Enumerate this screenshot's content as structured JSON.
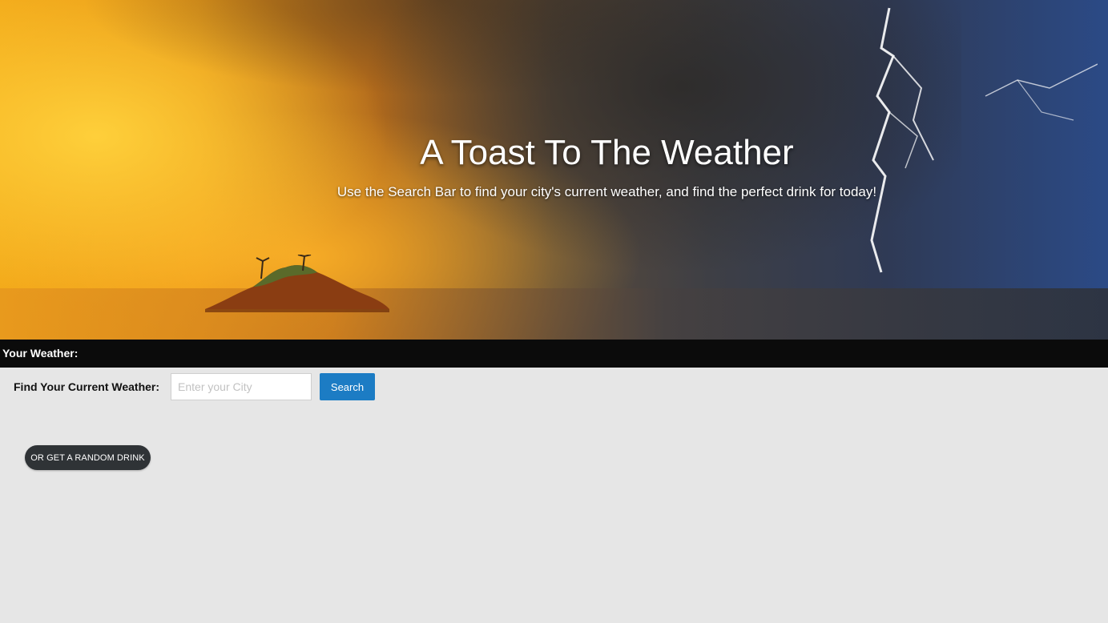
{
  "hero": {
    "title": "A Toast To The Weather",
    "subtitle": "Use the Search Bar to find your city's current weather, and find the perfect drink for today!",
    "background_image": "storm-over-sea-with-island-and-lightning"
  },
  "weather_bar": {
    "label": "Your Weather:"
  },
  "search": {
    "label": "Find Your Current Weather:",
    "placeholder": "Enter your City",
    "value": "",
    "button_label": "Search"
  },
  "random_drink": {
    "button_label": "OR GET A RANDOM DRINK"
  },
  "colors": {
    "page_background": "#e6e6e6",
    "bar_background": "#0b0b0b",
    "search_button": "#1c7cc4",
    "random_button": "#2f3336"
  }
}
